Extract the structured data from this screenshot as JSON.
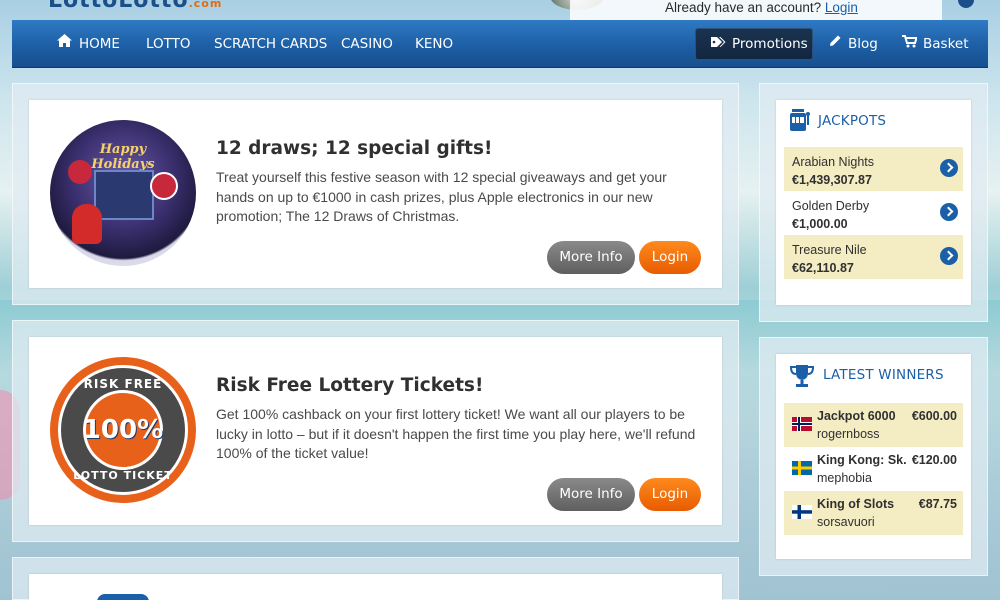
{
  "header": {
    "logo_text": "LottoLotto",
    "logo_domain": ".com",
    "account_prompt": "Already have an account?",
    "login_link": "Login"
  },
  "nav": {
    "items": [
      {
        "label": "HOME"
      },
      {
        "label": "LOTTO"
      },
      {
        "label": "SCRATCH CARDS"
      },
      {
        "label": "CASINO"
      },
      {
        "label": "KENO"
      }
    ],
    "promotions": "Promotions",
    "blog": "Blog",
    "basket": "Basket"
  },
  "promotions": [
    {
      "title": "12 draws; 12 special gifts!",
      "description": "Treat yourself this festive season with 12 special giveaways and get your hands on up to €1000 in cash prizes, plus Apple electronics in our new promotion; The 12 Draws of Christmas.",
      "image_caption": "Happy Holidays",
      "more_info": "More Info",
      "login": "Login"
    },
    {
      "title": "Risk Free Lottery Tickets!",
      "description": "Get 100% cashback on your first lottery ticket! We want all our players to be lucky in lotto – but if it doesn't happen the first time you play here, we'll refund 100% of the ticket value!",
      "badge_top": "RISK FREE",
      "badge_mid": "100%",
      "badge_bottom": "LOTTO TICKET",
      "more_info": "More Info",
      "login": "Login"
    }
  ],
  "jackpots": {
    "title": "JACKPOTS",
    "items": [
      {
        "name": "Arabian Nights",
        "amount": "€1,439,307.87"
      },
      {
        "name": "Golden Derby",
        "amount": "€1,000.00"
      },
      {
        "name": "Treasure Nile",
        "amount": "€62,110.87"
      }
    ]
  },
  "winners": {
    "title": "LATEST WINNERS",
    "items": [
      {
        "game": "Jackpot 6000",
        "amount": "€600.00",
        "user": "rogernboss",
        "flag": "norway"
      },
      {
        "game": "King Kong: Sk...",
        "amount": "€120.00",
        "user": "mephobia",
        "flag": "sweden"
      },
      {
        "game": "King of Slots",
        "amount": "€87.75",
        "user": "sorsavuori",
        "flag": "finland"
      }
    ]
  },
  "colors": {
    "nav_blue": "#1d5fa5",
    "accent_orange": "#e75c00",
    "jackpot_highlight": "#f4ecc3",
    "link_blue": "#1b5fa8"
  }
}
